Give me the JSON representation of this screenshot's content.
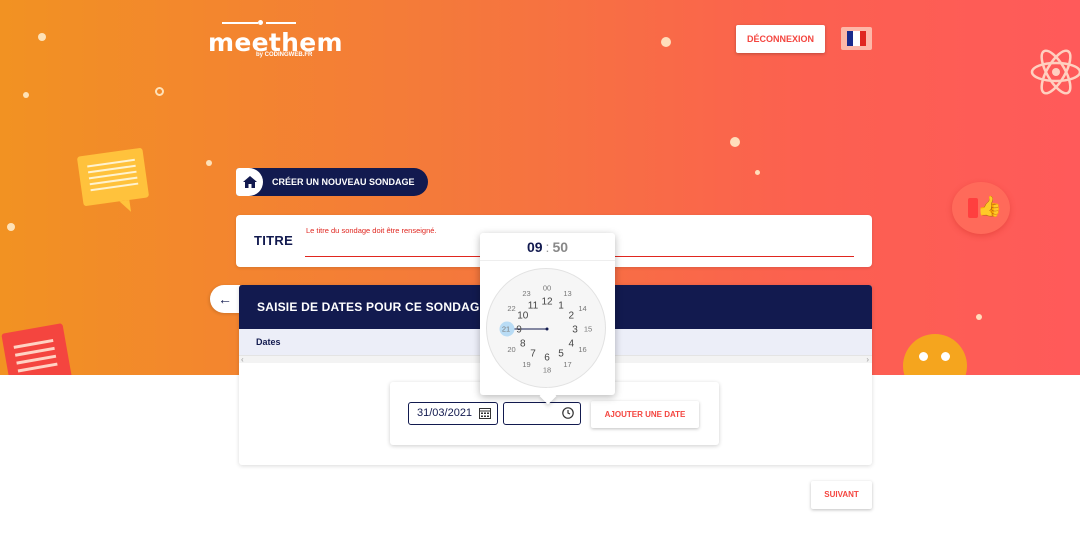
{
  "app": {
    "logo_word": "meethem",
    "logo_sub": "by CODINGWEB.FR"
  },
  "header": {
    "logout_label": "DÉCONNEXION",
    "language_flag": "fr"
  },
  "breadcrumb": {
    "home_icon": "home-icon",
    "label": "CRÉER UN NOUVEAU SONDAGE"
  },
  "title_form": {
    "label": "TITRE",
    "error": "Le titre du sondage doit être renseigné.",
    "value": ""
  },
  "dates_panel": {
    "title": "SAISIE DE DATES POUR CE SONDAGE",
    "column_header": "Dates",
    "date_value": "31/03/2021",
    "time_value": "",
    "add_label": "AJOUTER UNE DATE"
  },
  "time_picker": {
    "hours": "09",
    "separator": ":",
    "minutes": "50",
    "selected_hour": 9,
    "outer_hours": [
      "12",
      "1",
      "2",
      "3",
      "4",
      "5",
      "6",
      "7",
      "8",
      "9",
      "10",
      "11"
    ],
    "inner_hours": [
      "00",
      "13",
      "14",
      "15",
      "16",
      "17",
      "18",
      "19",
      "20",
      "21",
      "22",
      "23"
    ]
  },
  "footer": {
    "next_label": "SUIVANT"
  },
  "colors": {
    "navy": "#121a4f",
    "accent_red": "#f4453f",
    "gradient_start": "#f29222",
    "gradient_end": "#ff5a5a"
  }
}
